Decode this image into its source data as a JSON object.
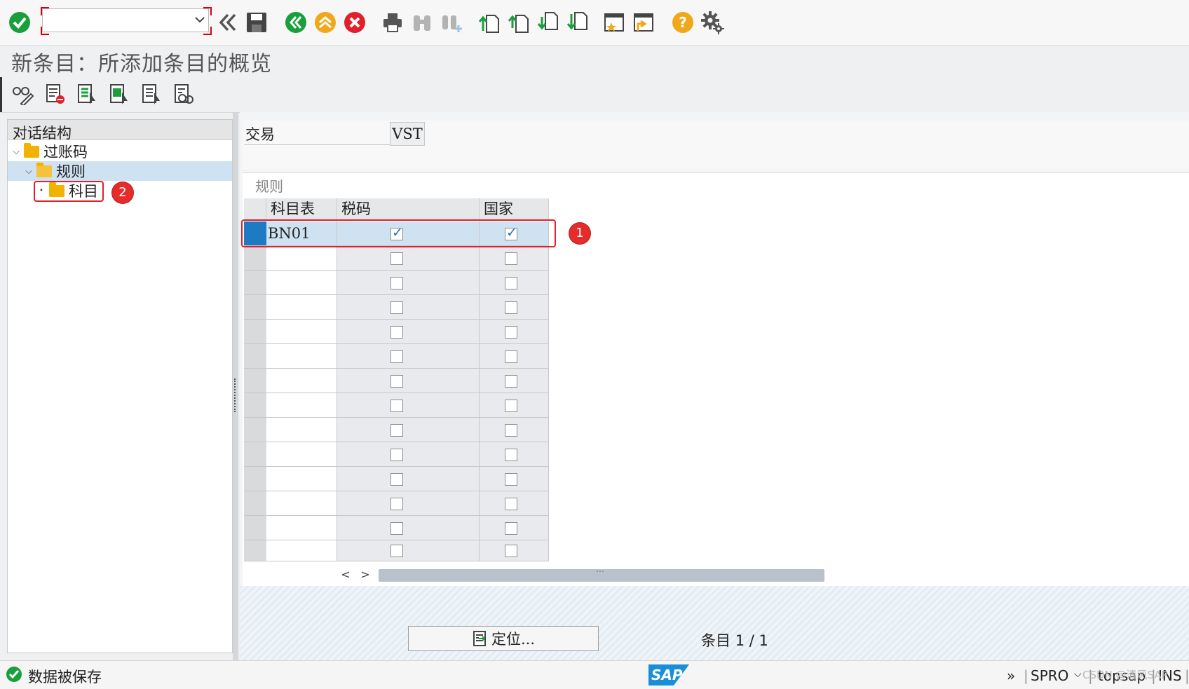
{
  "toolbar": {
    "command_field_value": "",
    "icons": [
      "enter-icon",
      "command-dropdown-icon",
      "collapse-icon",
      "save-icon",
      "back-icon",
      "exit-icon",
      "cancel-icon",
      "print-icon",
      "find-icon",
      "find-next-icon",
      "first-page-icon",
      "previous-page-icon",
      "next-page-icon",
      "last-page-icon",
      "create-session-icon",
      "shortcut-icon",
      "help-icon",
      "settings-icon"
    ]
  },
  "page": {
    "title": "新条目：所添加条目的概览"
  },
  "app_toolbar": {
    "icons": [
      "display-change-icon",
      "delete-icon",
      "select-all-icon",
      "select-block-icon",
      "deselect-all-icon",
      "bc-set-icon"
    ]
  },
  "tree": {
    "header": "对话结构",
    "items": [
      {
        "label": "过账码",
        "level": 0,
        "expanded": true
      },
      {
        "label": "规则",
        "level": 1,
        "expanded": true,
        "selected": true
      },
      {
        "label": "科目",
        "level": 2,
        "expanded": false
      }
    ]
  },
  "form": {
    "transaction_label": "交易",
    "transaction_value": "VST"
  },
  "table": {
    "title": "规则",
    "columns": [
      "科目表",
      "税码",
      "国家"
    ],
    "rows": [
      {
        "chart_of_accounts": "BN01",
        "tax_code": true,
        "country": true
      }
    ],
    "empty_rows": 13
  },
  "bottom": {
    "locate_button": "定位...",
    "entry_label": "条目",
    "entry_value": "1 / 1"
  },
  "status": {
    "message": "数据被保存",
    "transaction": "SPRO",
    "user": "topsap",
    "mode": "INS",
    "watermark": "CSDN @清风SAP"
  },
  "annotations": {
    "marker_1": "1",
    "marker_2": "2"
  },
  "colors": {
    "accent_green": "#1a9f3c",
    "accent_red": "#d0021b",
    "selection_blue": "#1f7ac4",
    "sap_blue": "#1a8fd7"
  }
}
